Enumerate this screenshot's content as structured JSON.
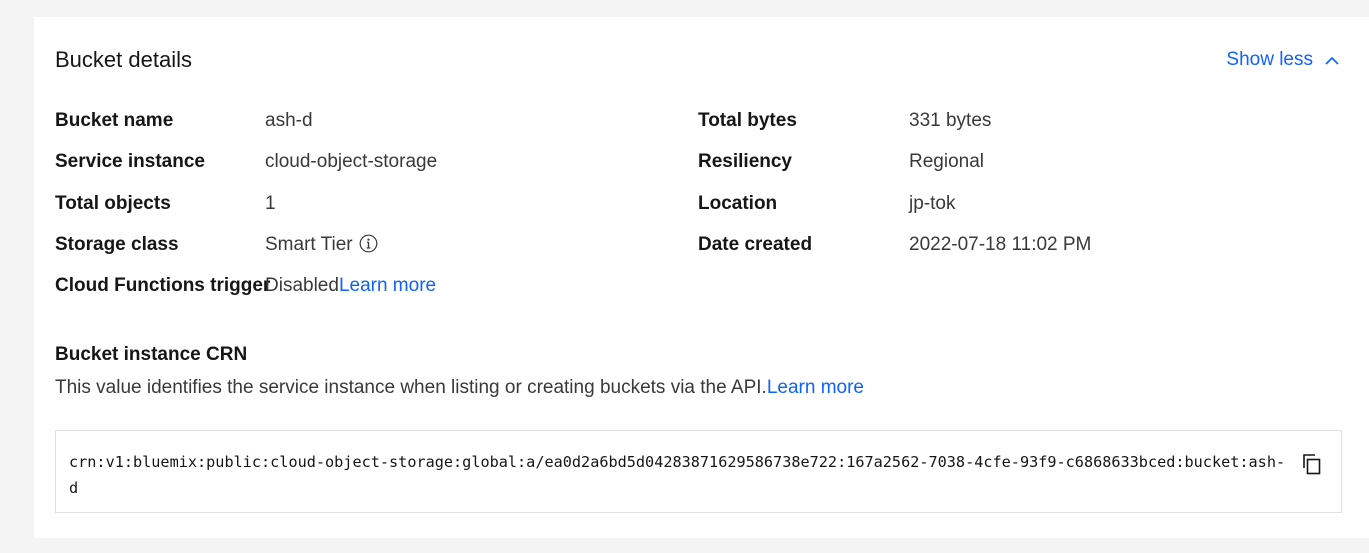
{
  "card": {
    "title": "Bucket details",
    "toggle_label": "Show less"
  },
  "details_left": [
    {
      "label": "Bucket name",
      "value": "ash-d"
    },
    {
      "label": "Service instance",
      "value": "cloud-object-storage"
    },
    {
      "label": "Total objects",
      "value": "1"
    },
    {
      "label": "Storage class",
      "value": "Smart Tier"
    },
    {
      "label": "Cloud Functions trigger",
      "value": "Disabled",
      "link": "Learn more"
    }
  ],
  "details_right": [
    {
      "label": "Total bytes",
      "value": "331 bytes"
    },
    {
      "label": "Resiliency",
      "value": "Regional"
    },
    {
      "label": "Location",
      "value": "jp-tok"
    },
    {
      "label": "Date created",
      "value": "2022-07-18 11:02 PM"
    }
  ],
  "crn": {
    "heading": "Bucket instance CRN",
    "description": "This value identifies the service instance when listing or creating buckets via the API.",
    "description_link": "Learn more",
    "value": "crn:v1:bluemix:public:cloud-object-storage:global:a/ea0d2a6bd5d04283871629586738e722:167a2562-7038-4cfe-93f9-c6868633bced:bucket:ash-d"
  },
  "icons": {
    "toggle": "chevron-up-icon",
    "storage_class_info": "info-icon",
    "copy": "copy-icon"
  },
  "colors": {
    "link": "#0f62fe",
    "background": "#f4f4f4",
    "card": "#ffffff"
  }
}
